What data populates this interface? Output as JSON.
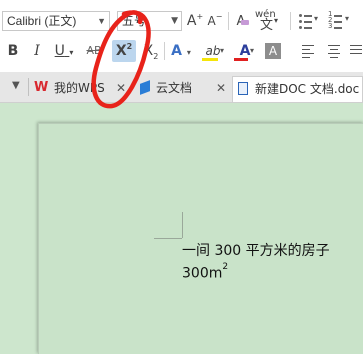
{
  "toolbar": {
    "font_name": "Calibri (正文)",
    "font_size": "五号",
    "grow_font": "A",
    "shrink_font": "A",
    "clear_format": "A",
    "phonetic": "wén",
    "bold": "B",
    "italic": "I",
    "underline": "U",
    "strikethrough": "AB",
    "superscript": "X",
    "superscript_mark": "2",
    "subscript": "X",
    "subscript_mark": "2",
    "text_effect": "A",
    "highlight": "ab",
    "font_color": "A",
    "char_shading": "A"
  },
  "tabs": [
    {
      "label": "我的WPS"
    },
    {
      "label": "云文档"
    },
    {
      "label": "新建DOC 文档.doc"
    }
  ],
  "document": {
    "line1": "一间 300 平方米的房子",
    "line2_base": "300m",
    "line2_sup": "2"
  },
  "colors": {
    "annotation": "#e8231a",
    "highlight_bar": "#f5e50a",
    "font_color_bar": "#e02020",
    "wps_logo": "#d8282f",
    "cloud_icon": "#2a7dd6",
    "page_bg": "#c9e3c9"
  }
}
